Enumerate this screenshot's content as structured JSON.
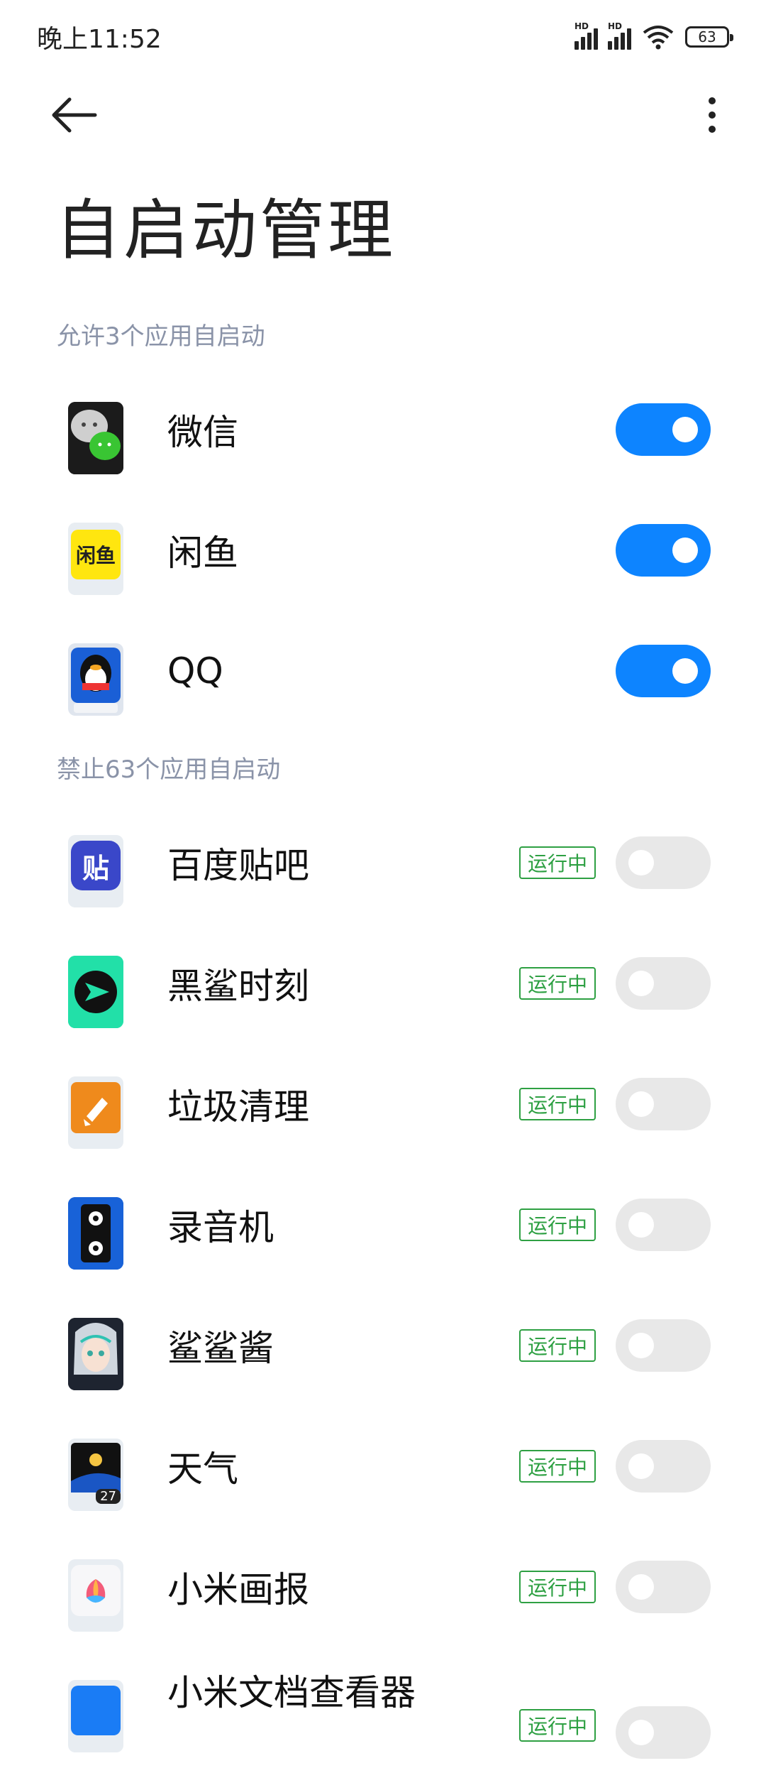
{
  "status": {
    "time": "晚上11:52",
    "signal1_label": "HD",
    "signal2_label": "HD",
    "battery": "63"
  },
  "header": {
    "title": "自启动管理"
  },
  "sections": {
    "allowed": "允许3个应用自启动",
    "forbidden": "禁止63个应用自启动"
  },
  "apps_allowed": [
    {
      "name": "微信",
      "enabled": true
    },
    {
      "name": "闲鱼",
      "enabled": true
    },
    {
      "name": "QQ",
      "enabled": true
    }
  ],
  "apps_forbidden": [
    {
      "name": "百度贴吧",
      "status": "运行中",
      "enabled": false
    },
    {
      "name": "黑鲨时刻",
      "status": "运行中",
      "enabled": false
    },
    {
      "name": "垃圾清理",
      "status": "运行中",
      "enabled": false
    },
    {
      "name": "录音机",
      "status": "运行中",
      "enabled": false
    },
    {
      "name": "鲨鲨酱",
      "status": "运行中",
      "enabled": false
    },
    {
      "name": "天气",
      "status": "运行中",
      "enabled": false
    },
    {
      "name": "小米画报",
      "status": "运行中",
      "enabled": false
    },
    {
      "name": "小米文档查看器",
      "status": "运行中",
      "enabled": false
    }
  ],
  "icon_text": {
    "xianyu": "闲鱼",
    "tieba": "贴",
    "weather_temp": "27"
  },
  "colors": {
    "accent": "#0d84ff",
    "toggle_off": "#e8e8e8",
    "running": "#2ea043",
    "section_header": "#8a93a8"
  }
}
